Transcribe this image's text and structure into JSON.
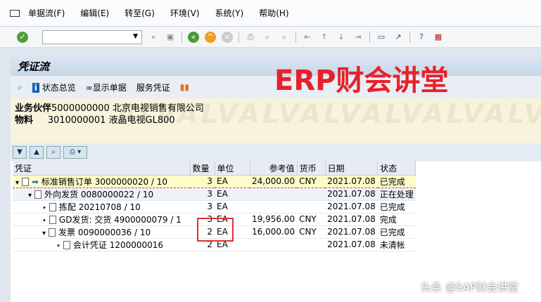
{
  "menu": [
    "单据流(F)",
    "编辑(E)",
    "转至(G)",
    "环境(V)",
    "系统(Y)",
    "帮助(H)"
  ],
  "title": "凭证流",
  "app_toolbar": {
    "status": "状态总览",
    "display": "显示单据",
    "service": "服务凭证"
  },
  "header": {
    "partner_label": "业务伙伴",
    "partner_value": "5000000000 北京电视销售有限公司",
    "material_label": "物料",
    "material_value": "3010000001 液晶电视GL800",
    "watermark": "ALVALVALVALVALVALVALVALV"
  },
  "columns": [
    "凭证",
    "数量",
    "单位",
    "参考值",
    "货币",
    "日期",
    "状态"
  ],
  "rows": [
    {
      "doc": "标准销售订单 3000000020 / 10",
      "qty": "3",
      "unit": "EA",
      "ref": "24,000.00",
      "cur": "CNY",
      "date": "2021.07.08",
      "status": "已完成"
    },
    {
      "doc": "外向发货 0080000022 / 10",
      "qty": "3",
      "unit": "EA",
      "ref": "",
      "cur": "",
      "date": "2021.07.08",
      "status": "正在处理"
    },
    {
      "doc": "拣配 20210708 / 10",
      "qty": "3",
      "unit": "EA",
      "ref": "",
      "cur": "",
      "date": "2021.07.08",
      "status": "已完成"
    },
    {
      "doc": "GD发货: 交货 4900000079 / 1",
      "qty": "3",
      "unit": "EA",
      "ref": "19,956.00",
      "cur": "CNY",
      "date": "2021.07.08",
      "status": "完成"
    },
    {
      "doc": "发票 0090000036 / 10",
      "qty": "2",
      "unit": "EA",
      "ref": "16,000.00",
      "cur": "CNY",
      "date": "2021.07.08",
      "status": "已完成"
    },
    {
      "doc": "会计凭证 1200000016",
      "qty": "2",
      "unit": "EA",
      "ref": "",
      "cur": "",
      "date": "2021.07.08",
      "status": "未清帐"
    }
  ],
  "watermark_erp": "ERP财会讲堂",
  "watermark_toutiao": "头条 @SAP财会讲堂"
}
